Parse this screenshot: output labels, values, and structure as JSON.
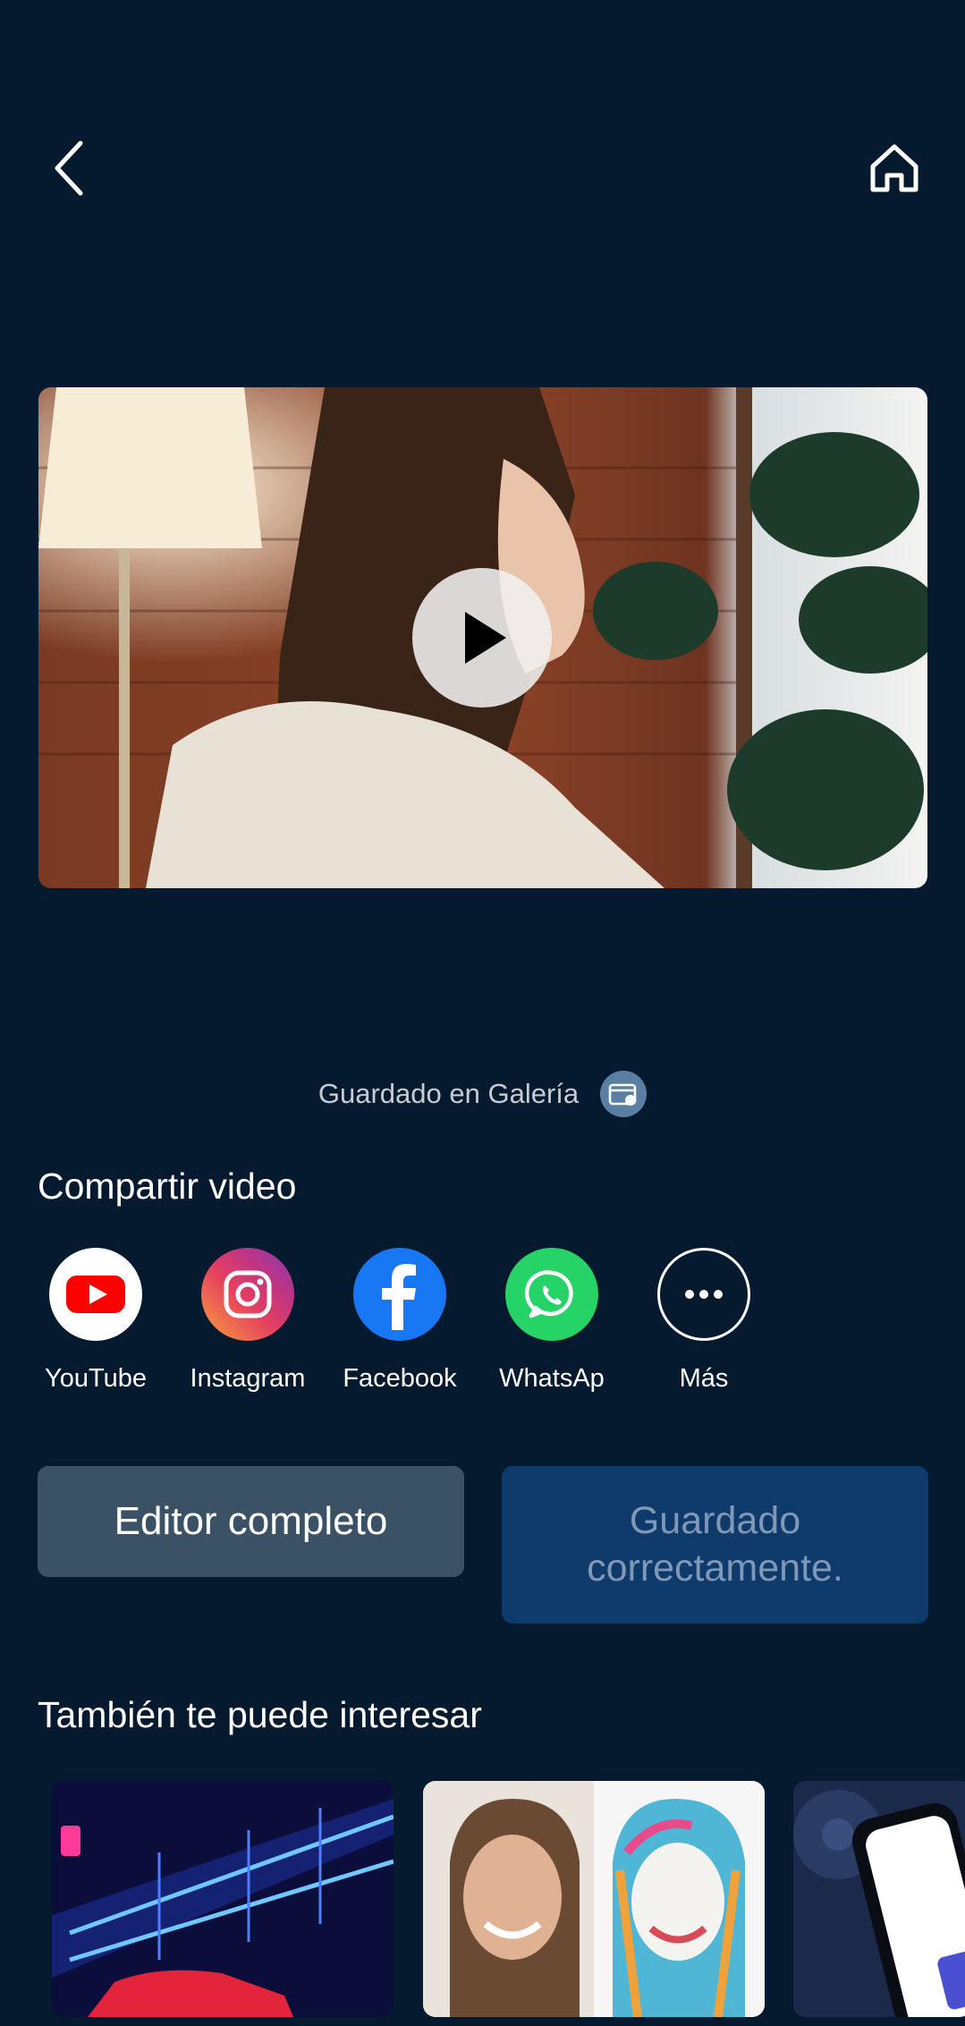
{
  "nav": {
    "back_icon": "chevron-left-icon",
    "home_icon": "home-icon"
  },
  "video": {
    "play_icon": "play-icon"
  },
  "save_status": {
    "text": "Guardado en Galería",
    "icon": "gallery-folder-icon"
  },
  "share": {
    "title": "Compartir video",
    "items": [
      {
        "label": "YouTube",
        "icon": "youtube-icon",
        "color": "#ff0000"
      },
      {
        "label": "Instagram",
        "icon": "instagram-icon",
        "color": "#c13584"
      },
      {
        "label": "Facebook",
        "icon": "facebook-icon",
        "color": "#1877f2"
      },
      {
        "label": "WhatsAp",
        "icon": "whatsapp-icon",
        "color": "#25d366"
      },
      {
        "label": "Más",
        "icon": "more-icon",
        "color": "#ffffff"
      }
    ]
  },
  "actions": {
    "editor_label": "Editor completo",
    "saved_label": "Guardado correctamente."
  },
  "recommendations": {
    "title": "También te puede interesar",
    "items": [
      {
        "name": "neon-car-thumbnail"
      },
      {
        "name": "portrait-art-thumbnail"
      },
      {
        "name": "ai-music-thumbnail"
      }
    ]
  },
  "colors": {
    "background": "#061a2f",
    "editor_button": "#3b5266",
    "saved_button": "#0e3a6c"
  }
}
